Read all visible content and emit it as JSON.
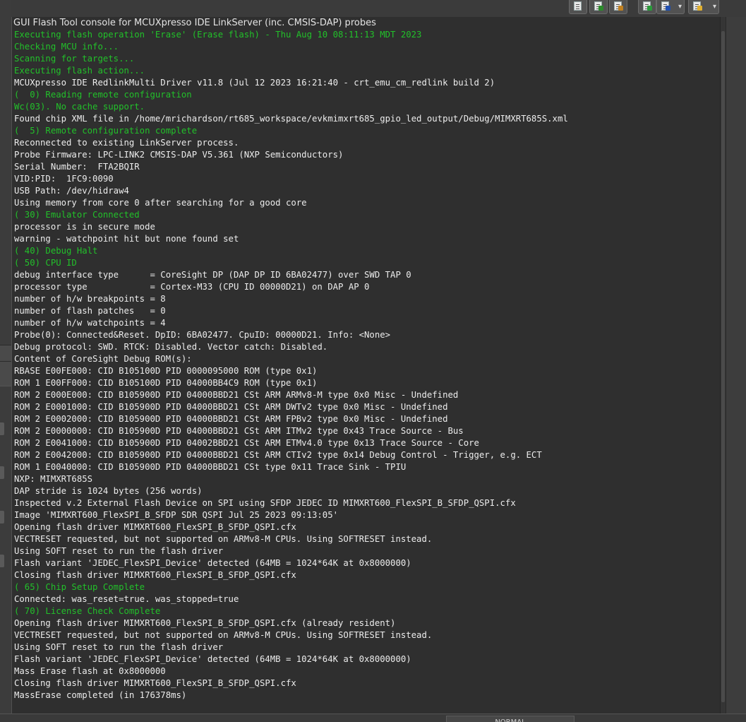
{
  "console": {
    "title": "GUI Flash Tool console for MCUXpresso IDE LinkServer (inc. CMSIS-DAP) probes",
    "lines": [
      {
        "text": "Executing flash operation 'Erase' (Erase flash) - Thu Aug 10 08:11:13 MDT 2023",
        "green": true
      },
      {
        "text": "Checking MCU info...",
        "green": true
      },
      {
        "text": "Scanning for targets...",
        "green": true
      },
      {
        "text": "Executing flash action...",
        "green": true
      },
      {
        "text": "MCUXpresso IDE RedlinkMulti Driver v11.8 (Jul 12 2023 16:21:40 - crt_emu_cm_redlink build 2)",
        "green": false
      },
      {
        "text": "(  0) Reading remote configuration",
        "green": true
      },
      {
        "text": "Wc(03). No cache support.",
        "green": true
      },
      {
        "text": "Found chip XML file in /home/mrichardson/rt685_workspace/evkmimxrt685_gpio_led_output/Debug/MIMXRT685S.xml",
        "green": false
      },
      {
        "text": "(  5) Remote configuration complete",
        "green": true
      },
      {
        "text": "Reconnected to existing LinkServer process.",
        "green": false
      },
      {
        "text": "Probe Firmware: LPC-LINK2 CMSIS-DAP V5.361 (NXP Semiconductors)",
        "green": false
      },
      {
        "text": "Serial Number:  FTA2BQIR",
        "green": false
      },
      {
        "text": "VID:PID:  1FC9:0090",
        "green": false
      },
      {
        "text": "USB Path: /dev/hidraw4",
        "green": false
      },
      {
        "text": "Using memory from core 0 after searching for a good core",
        "green": false
      },
      {
        "text": "( 30) Emulator Connected",
        "green": true
      },
      {
        "text": "processor is in secure mode",
        "green": false
      },
      {
        "text": "warning - watchpoint hit but none found set",
        "green": false
      },
      {
        "text": "( 40) Debug Halt",
        "green": true
      },
      {
        "text": "( 50) CPU ID",
        "green": true
      },
      {
        "text": "debug interface type      = CoreSight DP (DAP DP ID 6BA02477) over SWD TAP 0",
        "green": false
      },
      {
        "text": "processor type            = Cortex-M33 (CPU ID 00000D21) on DAP AP 0",
        "green": false
      },
      {
        "text": "number of h/w breakpoints = 8",
        "green": false
      },
      {
        "text": "number of flash patches   = 0",
        "green": false
      },
      {
        "text": "number of h/w watchpoints = 4",
        "green": false
      },
      {
        "text": "Probe(0): Connected&Reset. DpID: 6BA02477. CpuID: 00000D21. Info: <None>",
        "green": false
      },
      {
        "text": "Debug protocol: SWD. RTCK: Disabled. Vector catch: Disabled.",
        "green": false
      },
      {
        "text": "Content of CoreSight Debug ROM(s):",
        "green": false
      },
      {
        "text": "RBASE E00FE000: CID B105100D PID 0000095000 ROM (type 0x1)",
        "green": false
      },
      {
        "text": "ROM 1 E00FF000: CID B105100D PID 04000BB4C9 ROM (type 0x1)",
        "green": false
      },
      {
        "text": "ROM 2 E000E000: CID B105900D PID 04000BBD21 CSt ARM ARMv8-M type 0x0 Misc - Undefined",
        "green": false
      },
      {
        "text": "ROM 2 E0001000: CID B105900D PID 04000BBD21 CSt ARM DWTv2 type 0x0 Misc - Undefined",
        "green": false
      },
      {
        "text": "ROM 2 E0002000: CID B105900D PID 04000BBD21 CSt ARM FPBv2 type 0x0 Misc - Undefined",
        "green": false
      },
      {
        "text": "ROM 2 E0000000: CID B105900D PID 04000BBD21 CSt ARM ITMv2 type 0x43 Trace Source - Bus",
        "green": false
      },
      {
        "text": "ROM 2 E0041000: CID B105900D PID 04002BBD21 CSt ARM ETMv4.0 type 0x13 Trace Source - Core",
        "green": false
      },
      {
        "text": "ROM 2 E0042000: CID B105900D PID 04000BBD21 CSt ARM CTIv2 type 0x14 Debug Control - Trigger, e.g. ECT",
        "green": false
      },
      {
        "text": "ROM 1 E0040000: CID B105900D PID 04000BBD21 CSt type 0x11 Trace Sink - TPIU",
        "green": false
      },
      {
        "text": "NXP: MIMXRT685S",
        "green": false
      },
      {
        "text": "DAP stride is 1024 bytes (256 words)",
        "green": false
      },
      {
        "text": "Inspected v.2 External Flash Device on SPI using SFDP JEDEC ID MIMXRT600_FlexSPI_B_SFDP_QSPI.cfx",
        "green": false
      },
      {
        "text": "Image 'MIMXRT600_FlexSPI_B_SFDP SDR QSPI Jul 25 2023 09:13:05'",
        "green": false
      },
      {
        "text": "Opening flash driver MIMXRT600_FlexSPI_B_SFDP_QSPI.cfx",
        "green": false
      },
      {
        "text": "VECTRESET requested, but not supported on ARMv8-M CPUs. Using SOFTRESET instead.",
        "green": false
      },
      {
        "text": "Using SOFT reset to run the flash driver",
        "green": false
      },
      {
        "text": "Flash variant 'JEDEC_FlexSPI_Device' detected (64MB = 1024*64K at 0x8000000)",
        "green": false
      },
      {
        "text": "Closing flash driver MIMXRT600_FlexSPI_B_SFDP_QSPI.cfx",
        "green": false
      },
      {
        "text": "( 65) Chip Setup Complete",
        "green": true
      },
      {
        "text": "Connected: was_reset=true. was_stopped=true",
        "green": false
      },
      {
        "text": "( 70) License Check Complete",
        "green": true
      },
      {
        "text": "Opening flash driver MIMXRT600_FlexSPI_B_SFDP_QSPI.cfx (already resident)",
        "green": false
      },
      {
        "text": "VECTRESET requested, but not supported on ARMv8-M CPUs. Using SOFTRESET instead.",
        "green": false
      },
      {
        "text": "Using SOFT reset to run the flash driver",
        "green": false
      },
      {
        "text": "Flash variant 'JEDEC_FlexSPI_Device' detected (64MB = 1024*64K at 0x8000000)",
        "green": false
      },
      {
        "text": "Mass Erase flash at 0x8000000",
        "green": false
      },
      {
        "text": "Closing flash driver MIMXRT600_FlexSPI_B_SFDP_QSPI.cfx",
        "green": false
      },
      {
        "text": "MassErase completed (in 176378ms)",
        "green": false
      }
    ]
  },
  "toolbar": {
    "buttons": [
      {
        "icon": "document-lines-icon",
        "mark_color": ""
      },
      {
        "icon": "document-chart-icon",
        "mark_color": "#2a8a2a"
      },
      {
        "icon": "document-edit-icon",
        "mark_color": "#c08020"
      },
      {
        "icon": "display-console-icon",
        "mark_color": "#2a9a3a"
      },
      {
        "icon": "pin-console-icon",
        "mark_color": "#2050b0"
      },
      {
        "icon": "new-console-icon",
        "mark_color": "#e0b030"
      }
    ]
  },
  "colors": {
    "background": "#2f2f2f",
    "text": "#ececec",
    "green": "#22c02a"
  },
  "status": {
    "label": "NORMAL"
  }
}
